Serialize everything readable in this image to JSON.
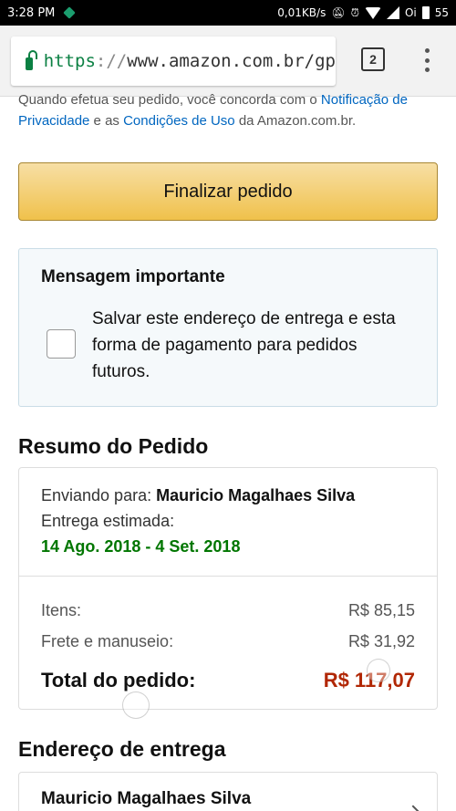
{
  "status_bar": {
    "time": "3:28 PM",
    "network_speed": "0,01KB/s",
    "carrier": "Oi",
    "battery": "55"
  },
  "browser": {
    "url_scheme": "https",
    "url_separator": "://",
    "url_host": "www.amazon.com.br/gp",
    "tab_count": "2"
  },
  "notice": {
    "text_before": "Quando efetua seu pedido, você concorda com o ",
    "privacy_link": "Notificação de Privacidade",
    "text_middle": " e as ",
    "terms_link": "Condições de Uso",
    "text_after": " da Amazon.com.br."
  },
  "finalize_button": {
    "label": "Finalizar pedido"
  },
  "important_message": {
    "title": "Mensagem importante",
    "save_label": "Salvar este endereço de entrega e esta forma de pagamento para pedidos futuros."
  },
  "summary": {
    "title": "Resumo do Pedido",
    "shipping_to_label": "Enviando para: ",
    "shipping_to_name": "Mauricio Magalhaes Silva",
    "eta_label": "Entrega estimada:",
    "eta_dates": "14 Ago. 2018 - 4 Set. 2018",
    "items_label": "Itens:",
    "items_value": "R$ 85,15",
    "shipping_label": "Frete e manuseio:",
    "shipping_value": "R$ 31,92",
    "total_label": "Total do pedido:",
    "total_value": "R$ 117,07"
  },
  "address": {
    "title": "Endereço de entrega",
    "name": "Mauricio Magalhaes Silva"
  },
  "colors": {
    "link": "#0066c0",
    "eta_green": "#007600",
    "total_red": "#b12704",
    "button_yellow": "#f0c14b"
  }
}
